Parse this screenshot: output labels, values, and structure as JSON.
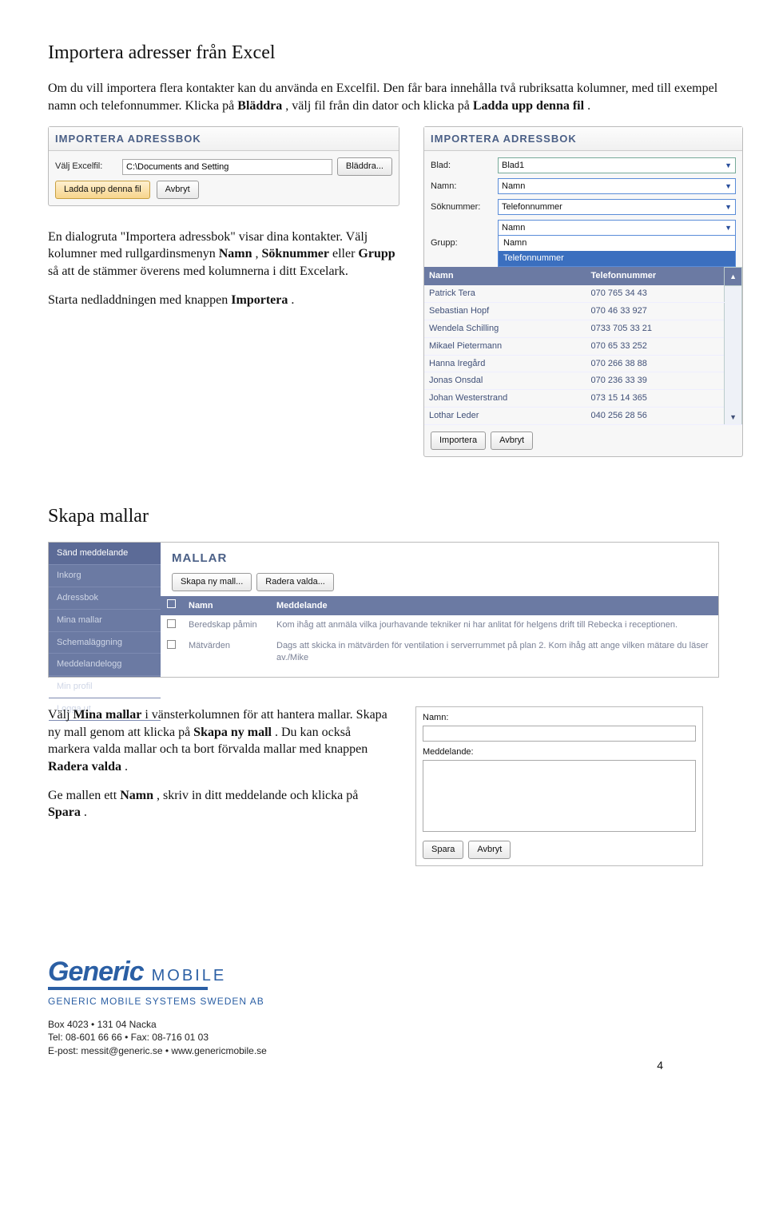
{
  "section1": {
    "heading": "Importera adresser från Excel",
    "para1_a": "Om du vill importera flera kontakter kan du använda en Excelfil. Den får bara innehålla två rubriksatta kolumner, med till exempel namn och telefonnummer. Klicka på ",
    "para1_bold1": "Bläddra",
    "para1_b": ", välj fil från din dator och klicka på ",
    "para1_bold2": "Ladda upp denna fil",
    "para1_c": ".",
    "para2_a": "En dialogruta \"Importera adressbok\" visar dina kontakter. Välj kolumner med rullgardinsmenyn ",
    "para2_b1": "Namn",
    "para2_b": ", ",
    "para2_b2": "Söknummer",
    "para2_c": " eller ",
    "para2_b3": "Grupp",
    "para2_d": " så att de stämmer överens med kolumnerna i ditt Excelark.",
    "para3_a": "Starta nedladdningen med knappen ",
    "para3_b": "Importera",
    "para3_c": "."
  },
  "panel1": {
    "title": "IMPORTERA ADRESSBOK",
    "label_file": "Välj Excelfil:",
    "file_value": "C:\\Documents and Setting",
    "btn_browse": "Bläddra...",
    "btn_upload": "Ladda upp denna fil",
    "btn_cancel": "Avbryt"
  },
  "panel2": {
    "title": "IMPORTERA ADRESSBOK",
    "label_blad": "Blad:",
    "blad_value": "Blad1",
    "label_namn": "Namn:",
    "namn_value": "Namn",
    "label_sok": "Söknummer:",
    "sok_value": "Telefonnummer",
    "label_grupp": "Grupp:",
    "grupp_opt1": "Namn",
    "grupp_opt2": "Telefonnummer",
    "th_namn": "Namn",
    "th_tel": "Telefonnummer",
    "rows": [
      {
        "n": "Patrick Tera",
        "t": "070 765 34 43"
      },
      {
        "n": "Sebastian Hopf",
        "t": "070 46 33 927"
      },
      {
        "n": "Wendela Schilling",
        "t": "0733 705 33 21"
      },
      {
        "n": "Mikael Pietermann",
        "t": "070 65 33 252"
      },
      {
        "n": "Hanna Iregård",
        "t": "070 266 38 88"
      },
      {
        "n": "Jonas Onsdal",
        "t": "070 236 33 39"
      },
      {
        "n": "Johan Westerstrand",
        "t": "073 15 14 365"
      },
      {
        "n": "Lothar Leder",
        "t": "040 256 28 56"
      }
    ],
    "btn_import": "Importera",
    "btn_cancel": "Avbryt"
  },
  "section2": {
    "heading": "Skapa mallar",
    "para1_a": "Välj ",
    "para1_b1": "Mina mallar",
    "para1_b": " i vänsterkolumnen för att hantera mallar. Skapa ny mall genom att klicka på ",
    "para1_b2": "Skapa ny mall",
    "para1_c": ". Du kan också markera valda mallar och ta bort förvalda mallar med knappen ",
    "para1_b3": "Radera valda",
    "para1_d": ".",
    "para2_a": "Ge mallen ett ",
    "para2_b1": "Namn",
    "para2_b": ", skriv in ditt meddelande och klicka på ",
    "para2_b2": "Spara",
    "para2_c": "."
  },
  "mallar": {
    "title": "MALLAR",
    "nav": [
      "Sänd meddelande",
      "Inkorg",
      "Adressbok",
      "Mina mallar",
      "Schemaläggning",
      "Meddelandelogg",
      "Min profil",
      "Logga ut"
    ],
    "btn_new": "Skapa ny mall...",
    "btn_del": "Radera valda...",
    "th_namn": "Namn",
    "th_med": "Meddelande",
    "rows": [
      {
        "n": "Beredskap påmin",
        "m": "Kom ihåg att anmäla vilka jourhavande tekniker ni har anlitat för helgens drift till Rebecka i receptionen."
      },
      {
        "n": "Mätvärden",
        "m": "Dags att skicka in mätvärden för ventilation i serverrummet på plan 2. Kom ihåg att ange vilken mätare du läser av./Mike"
      }
    ]
  },
  "miniform": {
    "lbl_namn": "Namn:",
    "lbl_med": "Meddelande:",
    "btn_save": "Spara",
    "btn_cancel": "Avbryt"
  },
  "footer": {
    "logo": "Generic",
    "logo_sub": "MOBILE",
    "company": "GENERIC MOBILE SYSTEMS SWEDEN AB",
    "line1": "Box 4023 • 131 04 Nacka",
    "line2": "Tel: 08-601 66 66 • Fax: 08-716 01 03",
    "line3": "E-post: messit@generic.se • www.genericmobile.se",
    "page": "4"
  }
}
